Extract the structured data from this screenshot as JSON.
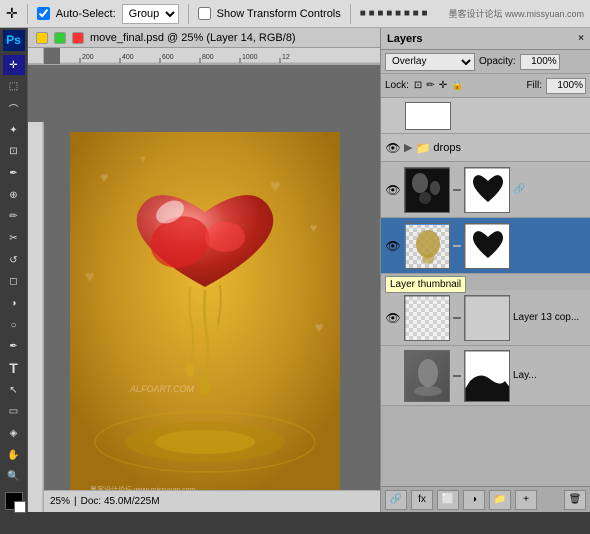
{
  "toolbar": {
    "auto_select_label": "Auto-Select:",
    "group_label": "Group",
    "transform_label": "Show Transform Controls",
    "move_icon": "✛",
    "title": "move_final.psd @ 25% (Layer 14, RGB/8)"
  },
  "layers_panel": {
    "title": "Layers",
    "close_label": "×",
    "blend_mode": "Overlay",
    "opacity_label": "Opacity:",
    "opacity_value": "100%",
    "fill_label": "Fill:",
    "fill_value": "100%",
    "lock_label": "Lock:",
    "group_name": "drops",
    "layers": [
      {
        "id": "layer-top",
        "name": "",
        "visible": true,
        "type": "blank"
      },
      {
        "id": "layer-drops-group",
        "name": "drops",
        "visible": true,
        "type": "group"
      },
      {
        "id": "layer-1",
        "name": "",
        "visible": true,
        "type": "layer-mask",
        "selected": false,
        "tooltip": ""
      },
      {
        "id": "layer-2",
        "name": "",
        "visible": true,
        "type": "layer-mask",
        "selected": true,
        "tooltip": "Layer thumbnail"
      },
      {
        "id": "layer-3",
        "name": "Layer 13 cop...",
        "visible": true,
        "type": "layer-mask",
        "selected": false,
        "tooltip": ""
      },
      {
        "id": "layer-4",
        "name": "Lay...",
        "visible": true,
        "type": "layer-mask",
        "selected": false,
        "tooltip": ""
      }
    ]
  },
  "status_bar": {
    "zoom": "25%",
    "info": "Doc: 45.0M/225M"
  },
  "rulers": {
    "marks": [
      "200",
      "400",
      "600",
      "800",
      "1000",
      "12"
    ]
  }
}
